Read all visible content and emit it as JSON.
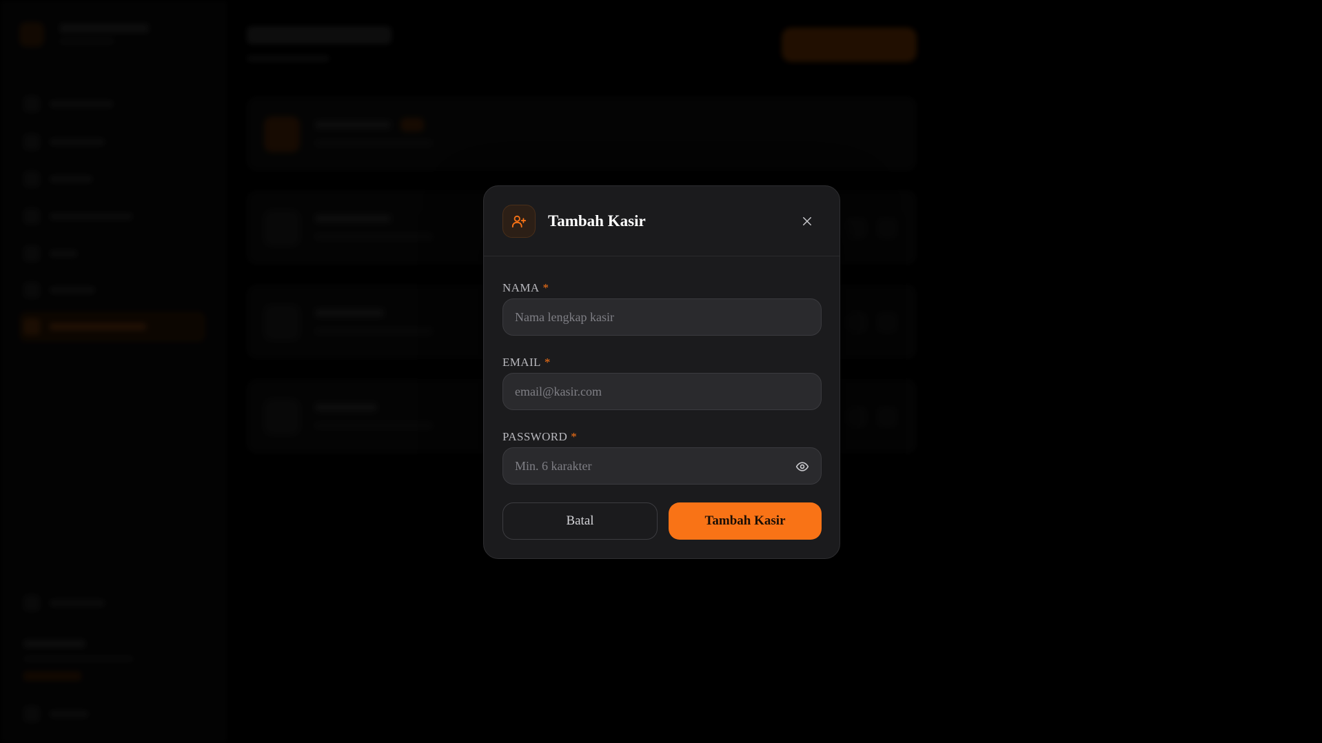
{
  "modal": {
    "title": "Tambah Kasir",
    "header_icon": "user-plus-icon",
    "close_icon": "close-icon",
    "fields": {
      "name": {
        "label": "NAMA",
        "required_mark": "*",
        "value": "",
        "placeholder": "Nama lengkap kasir"
      },
      "email": {
        "label": "EMAIL",
        "required_mark": "*",
        "value": "",
        "placeholder": "email@kasir.com"
      },
      "password": {
        "label": "PASSWORD",
        "required_mark": "*",
        "value": "",
        "placeholder": "Min. 6 karakter",
        "toggle_icon": "eye-icon"
      }
    },
    "cancel_label": "Batal",
    "submit_label": "Tambah Kasir"
  },
  "colors": {
    "accent": "#f97316",
    "modal_bg": "#1b1b1d",
    "input_bg": "#2a2a2d",
    "page_bg": "#000000"
  }
}
